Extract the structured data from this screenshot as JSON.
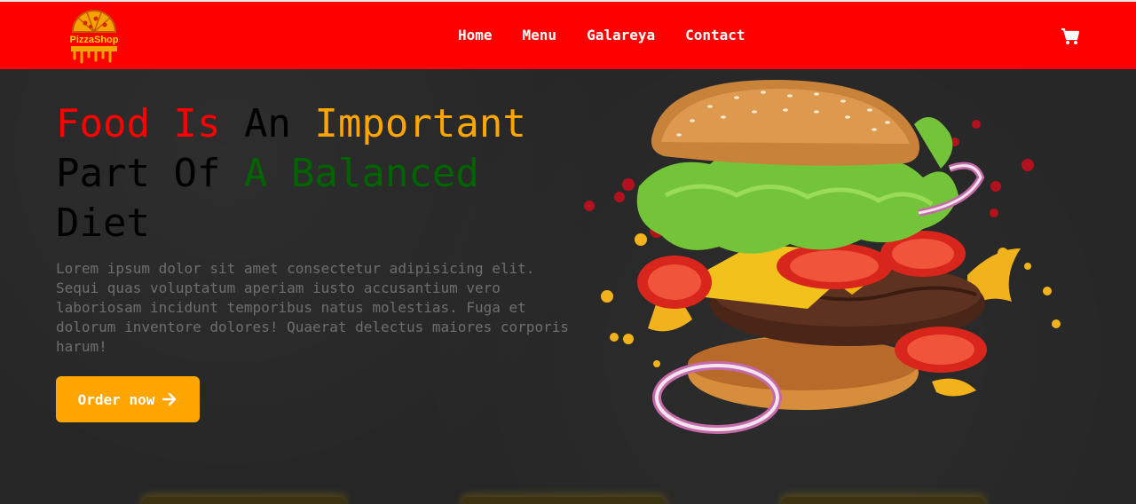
{
  "header": {
    "logo_text": "PizzaShop",
    "nav": [
      {
        "label": "Home"
      },
      {
        "label": "Menu"
      },
      {
        "label": "Galareya"
      },
      {
        "label": "Contact"
      }
    ],
    "cart_icon": "cart-icon"
  },
  "hero": {
    "headline_parts": [
      {
        "text": "Food ",
        "color": "#ff0000"
      },
      {
        "text": "Is ",
        "color": "#ff0000"
      },
      {
        "text": "An ",
        "color": "#000000"
      },
      {
        "text": "Important",
        "color": "#ffa500"
      },
      {
        "text": "Part Of ",
        "color": "#000000"
      },
      {
        "text": "A Balanced",
        "color": "#006400"
      },
      {
        "text": "Diet",
        "color": "#000000"
      }
    ],
    "description": "Lorem ipsum dolor sit amet consectetur adipisicing elit. Sequi quas voluptatum aperiam iusto accusantium vero laboriosam incidunt temporibus natus molestias. Fuga et dolorum inventore dolores! Quaerat delectus maiores corporis harum!",
    "order_button_label": "Order now",
    "order_button_icon": "arrow-right-icon"
  },
  "colors": {
    "header_bg": "#ff0000",
    "page_bg": "#262626",
    "accent": "#ffa500"
  }
}
